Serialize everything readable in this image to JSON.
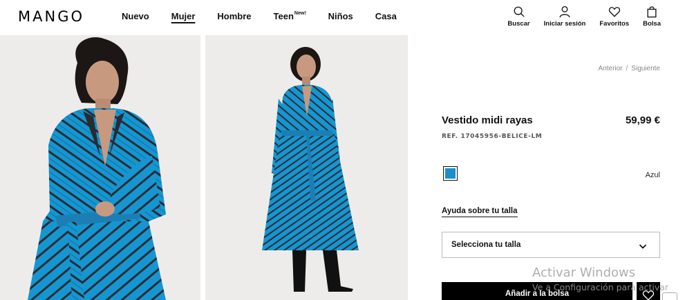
{
  "brand": {
    "logo_text": "MANGO"
  },
  "nav": {
    "items": [
      {
        "label": "Nuevo",
        "active": false
      },
      {
        "label": "Mujer",
        "active": true
      },
      {
        "label": "Hombre",
        "active": false
      },
      {
        "label": "Teen",
        "badge": "New!",
        "active": false
      },
      {
        "label": "Niños",
        "active": false
      },
      {
        "label": "Casa",
        "active": false
      }
    ]
  },
  "actions": {
    "search": {
      "label": "Buscar",
      "icon": "search-icon"
    },
    "login": {
      "label": "Iniciar sesión",
      "icon": "user-icon"
    },
    "favorites": {
      "label": "Favoritos",
      "icon": "heart-icon"
    },
    "bag": {
      "label": "Bolsa",
      "icon": "bag-icon"
    }
  },
  "pager": {
    "prev": "Anterior",
    "separator": "/",
    "next": "Siguiente"
  },
  "product": {
    "name": "Vestido midi rayas",
    "price": "59,99 €",
    "ref": "REF. 17045956-BELICE-LM",
    "color": {
      "name": "Azul",
      "hex": "#1a8fc9"
    },
    "size_help": "Ayuda sobre tu talla",
    "size_select_placeholder": "Selecciona tu talla",
    "add_to_bag": "Añadir a la bolsa"
  },
  "colors": {
    "dress": "#1596d0",
    "dress_dark": "#0e6fa3",
    "stripe": "#2a2a33",
    "background": "#eeecea"
  },
  "os_watermark": {
    "title": "Activar Windows",
    "subtitle": "Ve a Configuración para activar"
  }
}
